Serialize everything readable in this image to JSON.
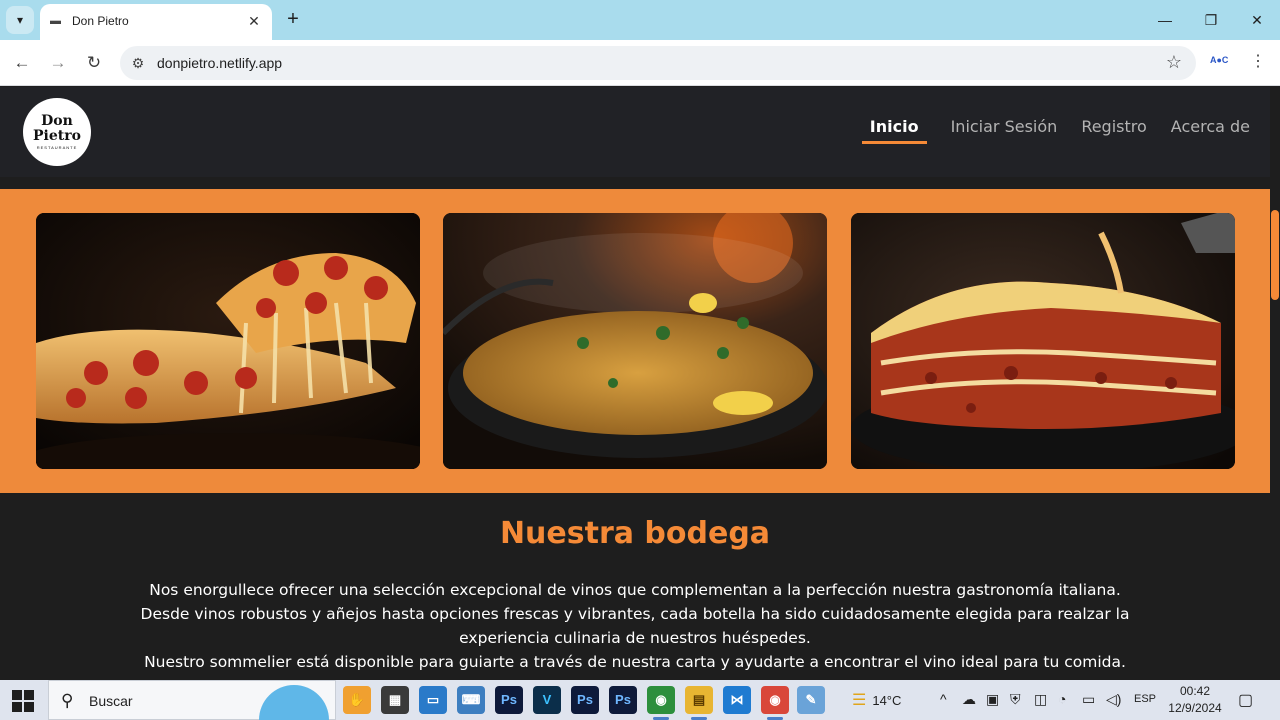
{
  "browser": {
    "tab_title": "Don Pietro",
    "url": "donpietro.netlify.app",
    "new_tab_symbol": "+",
    "close_tab_symbol": "✕"
  },
  "site": {
    "logo_line1": "Don",
    "logo_line2": "Pietro",
    "logo_sub": "RESTAURANTE",
    "nav": [
      {
        "label": "Inicio",
        "active": true
      },
      {
        "label": "Iniciar Sesión",
        "active": false
      },
      {
        "label": "Registro",
        "active": false
      },
      {
        "label": "Acerca de",
        "active": false
      }
    ],
    "accent_color": "#f58a37",
    "band_color": "#ee8a3b",
    "photos": [
      "pizza-photo",
      "paella-photo",
      "lasagna-photo"
    ],
    "section_title": "Nuestra bodega",
    "section_paragraphs": [
      "Nos enorgullece ofrecer una selección excepcional de vinos que complementan a la perfección nuestra gastronomía italiana.",
      "Desde vinos robustos y añejos hasta opciones frescas y vibrantes, cada botella ha sido cuidadosamente elegida para realzar la experiencia culinaria de nuestros huéspedes.",
      "Nuestro sommelier está disponible para guiarte a través de nuestra carta y ayudarte a encontrar el vino ideal para tu comida."
    ]
  },
  "taskbar": {
    "search_label": "Buscar",
    "weather": "14°C",
    "language": "ESP",
    "time": "00:42",
    "date": "12/9/2024"
  }
}
